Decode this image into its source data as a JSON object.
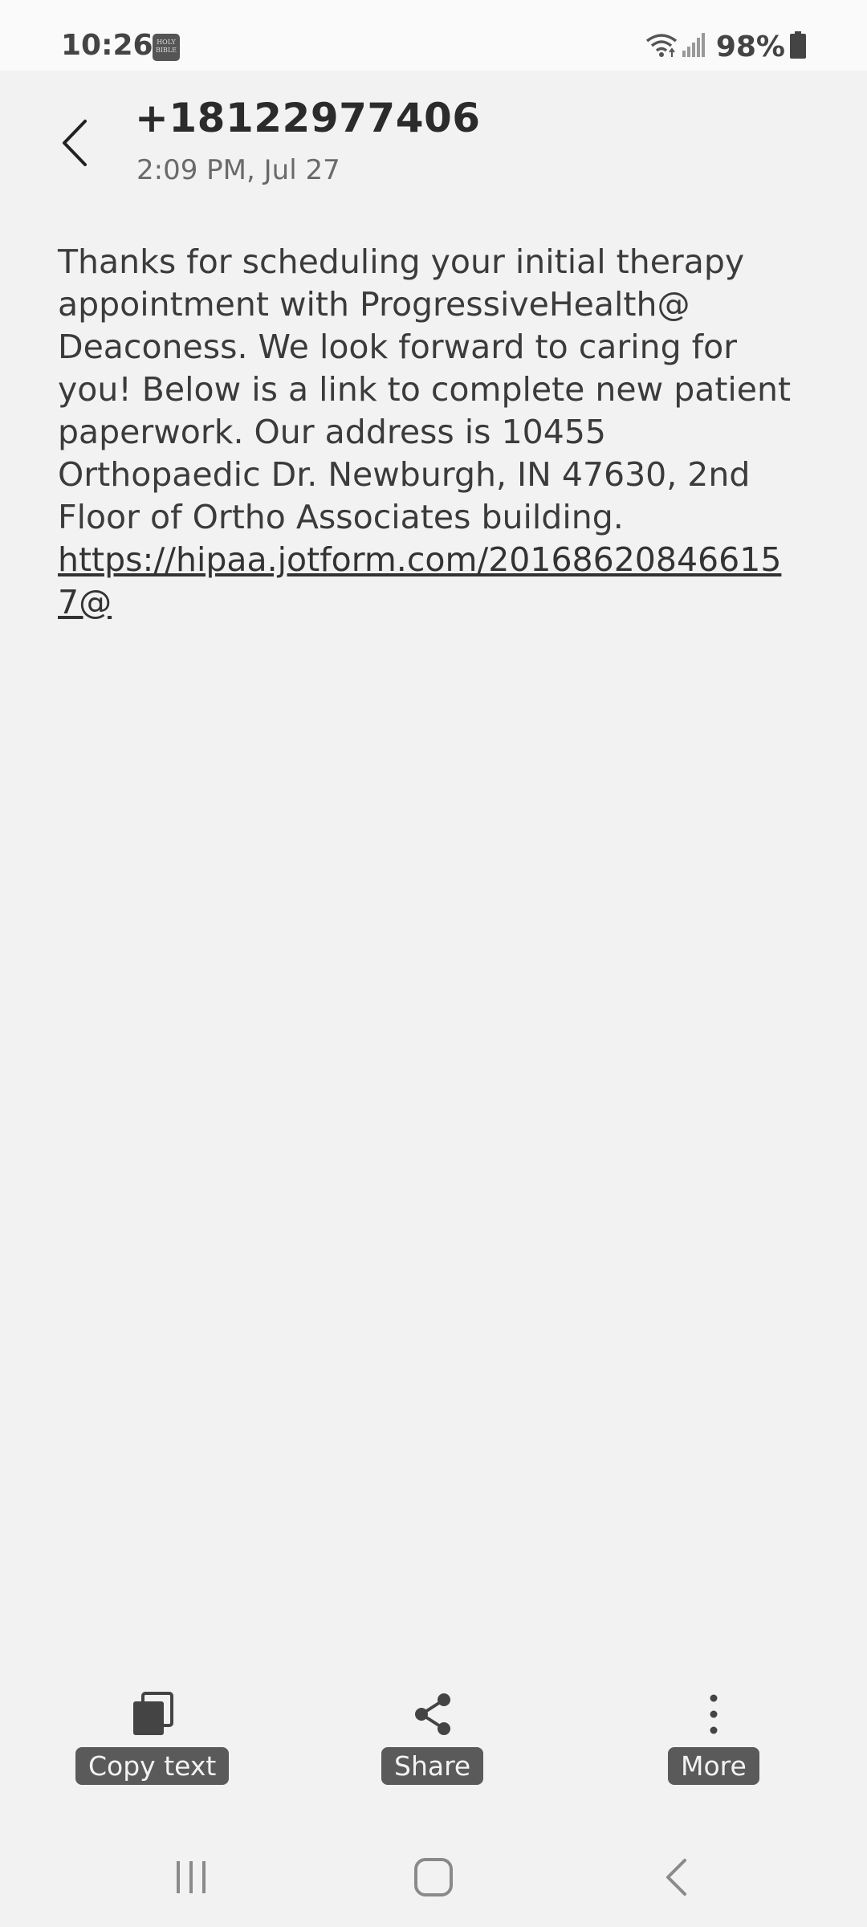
{
  "status_bar": {
    "time": "10:26",
    "app_icon": "bible-app-icon",
    "app_icon_text": "HOLY BIBLE",
    "battery": "98%"
  },
  "header": {
    "back_icon": "chevron-left-icon",
    "contact": "+18122977406",
    "timestamp": "2:09 PM, Jul 27"
  },
  "message": {
    "text": "Thanks for scheduling your initial therapy appointment with ProgressiveHealth@ Deaconess. We look forward to caring for you! Below is a link to complete new patient paperwork. Our address is 10455 Orthopaedic Dr. Newburgh, IN 47630, 2nd Floor of Ortho Associates building. ",
    "link": "https://hipaa.jotform.com/201686208466157@"
  },
  "actions": {
    "copy_label": "Copy text",
    "share_label": "Share",
    "more_label": "More"
  },
  "colors": {
    "background": "#f2f2f2",
    "text": "#3b3b3b",
    "label_bg": "#5a5a5a"
  }
}
